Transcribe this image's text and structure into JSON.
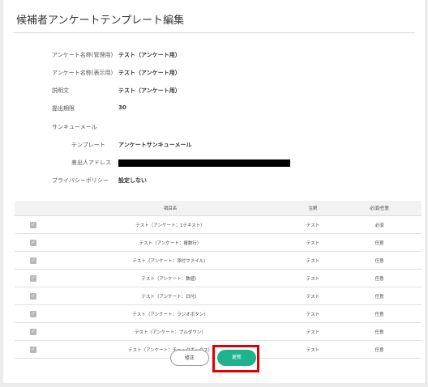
{
  "page": {
    "title": "候補者アンケートテンプレート編集"
  },
  "form": [
    {
      "label": "アンケート名称(管理用)",
      "value": "テスト（アンケート用）"
    },
    {
      "label": "アンケート名称(表示用)",
      "value": "テスト（アンケート用）"
    },
    {
      "label": "説明文",
      "value": "テスト（アンケート用）"
    },
    {
      "label": "提出期限",
      "value": "30"
    },
    {
      "label": "サンキューメール",
      "value": ""
    },
    {
      "label": "テンプレート",
      "value": "アンケートサンキューメール"
    },
    {
      "label": "差出人アドレス",
      "value": "[redacted]"
    },
    {
      "label": "プライバシーポリシー",
      "value": "設定しない"
    }
  ],
  "table": {
    "headers": {
      "item": "項目名",
      "note": "注釈",
      "required": "必須/任意"
    },
    "rows": [
      {
        "name": "テスト（アンケート：1テキスト）",
        "note": "テスト",
        "required": "必須"
      },
      {
        "name": "テスト（アンケート：複数行）",
        "note": "テスト",
        "required": "任意"
      },
      {
        "name": "テスト（アンケート：添付ファイル）",
        "note": "テスト",
        "required": "任意"
      },
      {
        "name": "テスト（アンケート：数値）",
        "note": "テスト",
        "required": "任意"
      },
      {
        "name": "テスト（アンケート：日付）",
        "note": "テスト",
        "required": "任意"
      },
      {
        "name": "テスト（アンケート：ラジオボタン）",
        "note": "テスト",
        "required": "任意"
      },
      {
        "name": "テスト（アンケート：プルダウン）",
        "note": "テスト",
        "required": "任意"
      },
      {
        "name": "テスト（アンケート：チェックボックス）",
        "note": "テスト",
        "required": "任意"
      }
    ]
  },
  "buttons": {
    "edit": "修正",
    "update": "更新"
  },
  "colors": {
    "accent": "#1fb38d",
    "highlight": "#e00000"
  }
}
